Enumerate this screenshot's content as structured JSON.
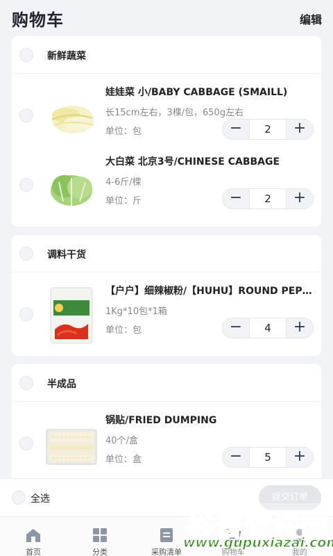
{
  "header": {
    "title": "购物车",
    "edit_label": "编辑"
  },
  "cart": {
    "groups": [
      {
        "category": "新鲜蔬菜",
        "items": [
          {
            "name": "娃娃菜 小/BABY CABBAGE (SMAILL)",
            "spec": "长15cm左右，3棵/包，650g左右",
            "unit": "单位：包",
            "qty": "2",
            "minus": "−",
            "plus": "+"
          },
          {
            "name": "大白菜 北京3号/CHINESE CABBAGE",
            "spec": "4-6斤/棵",
            "unit": "单位：斤",
            "qty": "2",
            "minus": "−",
            "plus": "+"
          }
        ]
      },
      {
        "category": "调料干货",
        "items": [
          {
            "name": "【户户】细辣椒粉/【HUHU】ROUND PEPPER POWDER",
            "spec": "1Kg*10包*1箱",
            "unit": "单位：包",
            "qty": "4",
            "minus": "−",
            "plus": "+"
          }
        ]
      },
      {
        "category": "半成品",
        "items": [
          {
            "name": "锅贴/FRIED DUMPING",
            "spec": "40个/盒",
            "unit": "单位：盒",
            "qty": "5",
            "minus": "−",
            "plus": "+"
          }
        ]
      }
    ]
  },
  "bottom_bar": {
    "select_all_label": "全选",
    "submit_label": "提交订单"
  },
  "tabbar": {
    "tabs": [
      {
        "label": "首页",
        "icon": "home-icon"
      },
      {
        "label": "分类",
        "icon": "grid-icon"
      },
      {
        "label": "采购清单",
        "icon": "list-icon"
      },
      {
        "label": "购物车",
        "icon": "cart-icon"
      },
      {
        "label": "我的",
        "icon": "user-icon"
      }
    ]
  },
  "watermark": {
    "title": "谷普软件园",
    "url": "www.gupuxiazai.com"
  },
  "colors": {
    "accent": "#2e3a55",
    "watermark_green": "#5ab72f",
    "page_bg": "#f1f3f7"
  }
}
